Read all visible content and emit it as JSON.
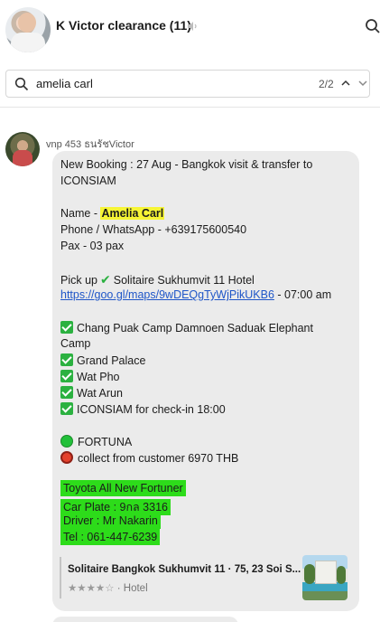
{
  "header": {
    "title": "K Victor clearance (11)"
  },
  "search": {
    "query": "amelia carl",
    "match_count": "2/2"
  },
  "message": {
    "sender": "vnp 453 ธนรัชVictor",
    "lines": {
      "l1": "New Booking : 27 Aug - Bangkok visit & transfer to",
      "l2": "ICONSIAM",
      "name_prefix": "Name - ",
      "name_value": "Amelia Carl",
      "phone": "Phone / WhatsApp - +639175600540",
      "pax": "Pax - 03 pax",
      "pickup_prefix": "Pick up",
      "pickup_place": "Solitaire Sukhumvit 11 Hotel",
      "map_link": "https://goo.gl/maps/9wDEQgTyWjPikUKB6",
      "pickup_time": " - 07:00 am",
      "stop1a": "Chang Puak Camp Damnoen Saduak Elephant",
      "stop1b": "Camp",
      "stop2": "Grand Palace",
      "stop3": "Wat Pho",
      "stop4": "Wat Arun",
      "stop5": "ICONSIAM for check-in 18:00",
      "vehicle_tag": "FORTUNA",
      "collect": "collect from customer 6970 THB",
      "car_model": "Toyota All New Fortuner",
      "car_plate": "Car Plate : 9กล 3316",
      "driver": "Driver : Mr Nakarin",
      "tel": "Tel : 061-447-6239"
    },
    "preview": {
      "title": "Solitaire Bangkok Sukhumvit 11 · 75, 23 Soi S...",
      "stars": "★★★★☆",
      "category": " · Hotel"
    }
  },
  "colors": {
    "highlight_yellow": "#f6f535",
    "highlight_green": "#2ddc1a",
    "link": "#1f56c8",
    "bubble": "#ebebeb",
    "check_green": "#2bb140"
  },
  "icons": {
    "header_mute": "speaker-muted-icon",
    "header_search": "search-icon",
    "search_field": "search-icon",
    "prev_match": "chevron-up-icon",
    "next_match": "chevron-down-icon"
  }
}
